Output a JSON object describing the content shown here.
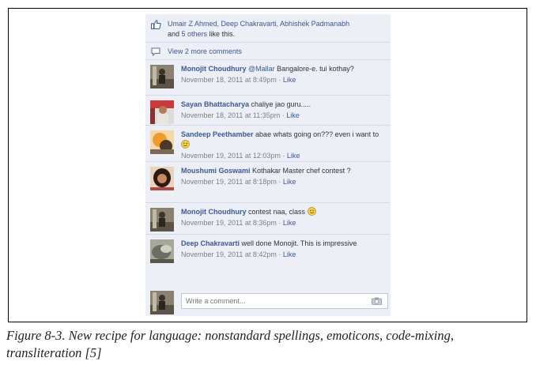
{
  "likes": {
    "names": "Umair Z Ahmed, Deep Chakravarti, Abhishek Padmanabh",
    "and_text": "and ",
    "others_link": "5 others",
    "like_this": " like this."
  },
  "view_more": "View 2 more comments",
  "comments": [
    {
      "author": "Monojit Choudhury",
      "mention": "@Mallar",
      "text_after_mention": " Bangalore-e. tui kothay?",
      "time": "November 18, 2011 at 8:49pm",
      "sep": " · ",
      "like": "Like"
    },
    {
      "author": "Sayan Bhattacharya",
      "text": " chaliye jao guru.....",
      "time": "November 18, 2011 at 11:35pm",
      "sep": " · ",
      "like": "Like"
    },
    {
      "author": "Sandeep Peethamber",
      "text": " abae whats going on??? even i want to ",
      "time": "November 19, 2011 at 12:03pm",
      "sep": " · ",
      "like": "Like",
      "emoticon": "smile-emoticon"
    },
    {
      "author": "Moushumi Goswami",
      "text": " Kothakar Master chef contest ?",
      "time": "November 19, 2011 at 8:18pm",
      "sep": " · ",
      "like": "Like"
    },
    {
      "author": "Monojit Choudhury",
      "text": " contest naa, class ",
      "time": "November 19, 2011 at 8:36pm",
      "sep": " · ",
      "like": "Like",
      "emoticon": "smile-emoticon"
    },
    {
      "author": "Deep Chakravarti",
      "text": " well done Monojit. This is impressive",
      "time": "November 19, 2011 at 8:42pm",
      "sep": " · ",
      "like": "Like"
    }
  ],
  "write_comment_placeholder": "Write a comment...",
  "caption": "Figure 8-3. New recipe for language: nonstandard spellings, emoticons, code-mixing, transliteration [5]",
  "colors": {
    "link": "#3b5998",
    "panel_bg": "#eceff5",
    "meta": "#808080"
  },
  "icons": [
    "thumbs-up-icon",
    "comment-bubble-icon",
    "smile-emoticon",
    "camera-icon"
  ]
}
